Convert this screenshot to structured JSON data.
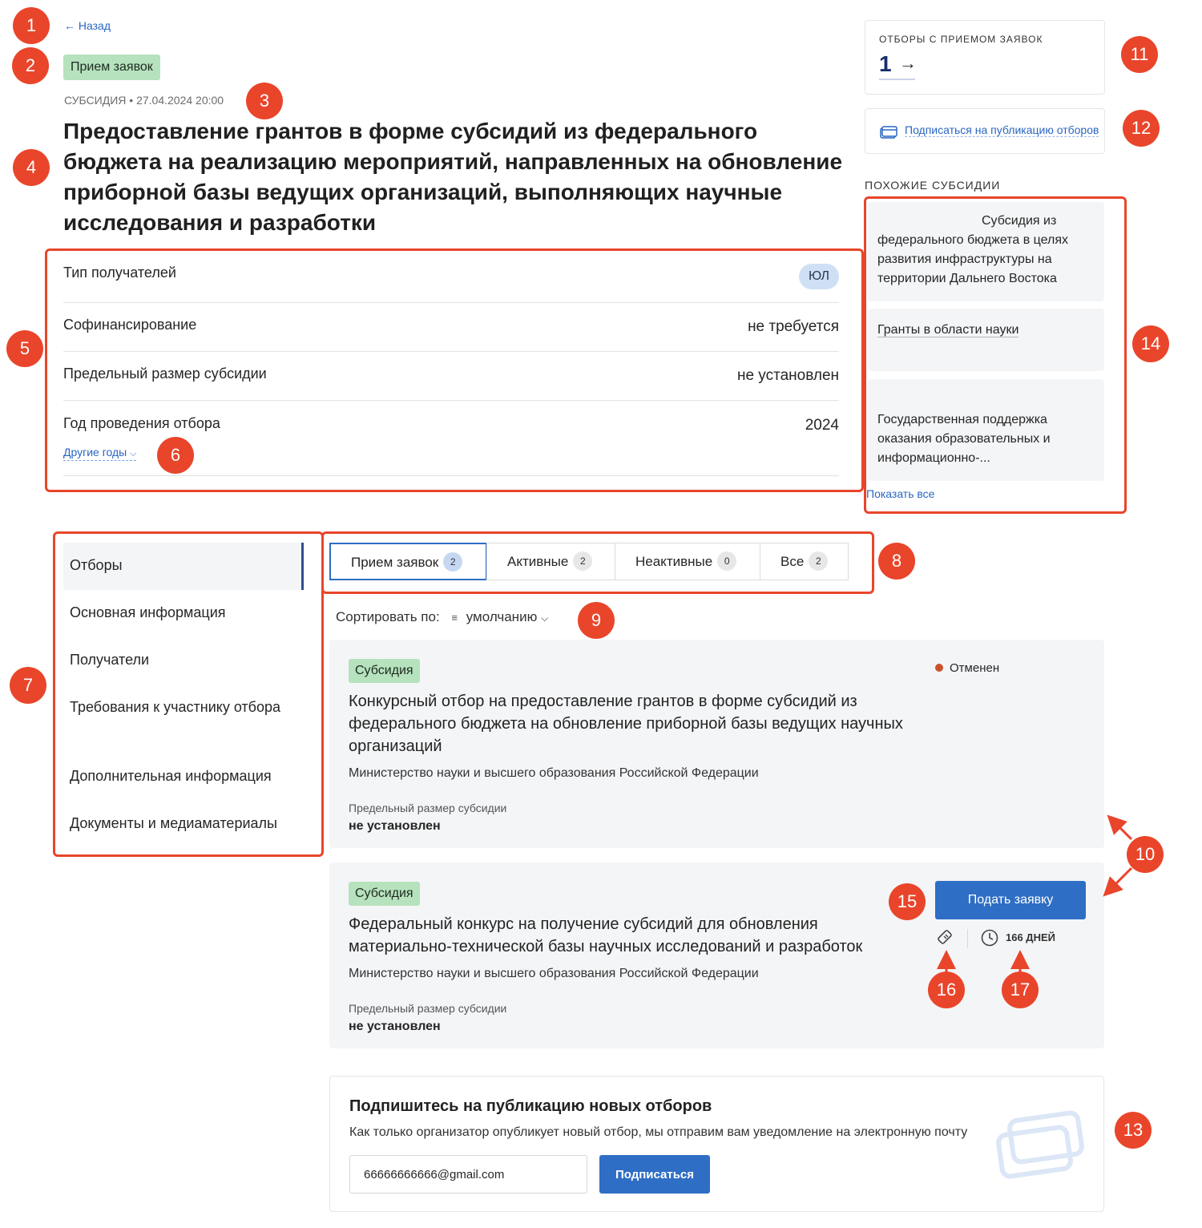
{
  "header": {
    "back_label": "Назад",
    "status_tag": "Прием заявок",
    "meta": "СУБСИДИЯ • 27.04.2024 20:00",
    "title": "Предоставление грантов в форме субсидий из федерального бюджета на реализацию мероприятий, направленных на обновление приборной базы ведущих организаций, выполняющих научные исследования и разработки"
  },
  "info": {
    "recipient_type_label": "Тип получателей",
    "recipient_type_badge": "ЮЛ",
    "cofinancing_label": "Софинансирование",
    "cofinancing_value": "не требуется",
    "limit_label": "Предельный размер субсидии",
    "limit_value": "не установлен",
    "year_label": "Год проведения отбора",
    "year_value": "2024",
    "other_years": "Другие годы"
  },
  "sidebar": {
    "count_label": "ОТБОРЫ С ПРИЕМОМ ЗАЯВОК",
    "count_value": "1",
    "subscribe_link": "Подписаться на публикацию отборов",
    "similar_title": "ПОХОЖИЕ СУБСИДИИ",
    "similar": [
      {
        "title": "Субсидия из федерального бюджета в целях развития инфраструктуры на территории Дальнего Востока"
      },
      {
        "title": "Гранты в области науки"
      },
      {
        "title": "Государственная поддержка оказания образовательных и информационно-..."
      }
    ],
    "show_all": "Показать все"
  },
  "nav": {
    "items": [
      {
        "label": "Отборы"
      },
      {
        "label": "Основная информация"
      },
      {
        "label": "Получатели"
      },
      {
        "label": "Требования к участнику отбора"
      },
      {
        "label": "Дополнительная информация"
      },
      {
        "label": "Документы и медиаматериалы"
      }
    ]
  },
  "tabs": [
    {
      "label": "Прием заявок",
      "count": "2"
    },
    {
      "label": "Активные",
      "count": "2"
    },
    {
      "label": "Неактивные",
      "count": "0"
    },
    {
      "label": "Все",
      "count": "2"
    }
  ],
  "sort": {
    "label": "Сортировать по:",
    "value": "умолчанию"
  },
  "cards": [
    {
      "tag": "Субсидия",
      "status": "Отменен",
      "title": "Конкурсный отбор на предоставление грантов в форме субсидий из федерального бюджета на обновление приборной базы ведущих научных организаций",
      "org": "Министерство науки и высшего образования Российской Федерации",
      "limit_label": "Предельный размер субсидии",
      "limit_value": "не установлен"
    },
    {
      "tag": "Субсидия",
      "title": "Федеральный конкурс на получение субсидий для обновления материально-технической базы научных исследований и разработок",
      "org": "Министерство науки и высшего образования Российской Федерации",
      "limit_label": "Предельный размер субсидии",
      "limit_value": "не установлен",
      "apply_label": "Подать заявку",
      "days_left": "166 ДНЕЙ"
    }
  ],
  "subscribe": {
    "title": "Подпишитесь на публикацию новых отборов",
    "description": "Как только организатор опубликует новый отбор, мы отправим вам уведомление на электронную почту",
    "email_value": "66666666666@gmail.com",
    "button_label": "Подписаться"
  },
  "annotations": [
    "1",
    "2",
    "3",
    "4",
    "5",
    "6",
    "7",
    "8",
    "9",
    "10",
    "11",
    "12",
    "13",
    "14",
    "15",
    "16",
    "17"
  ],
  "colors": {
    "accent": "#2f6ec5",
    "link": "#2a66c2",
    "marker": "#e9452b",
    "status_tag": "#b6e2bd",
    "canceled_dot": "#c9532c"
  }
}
